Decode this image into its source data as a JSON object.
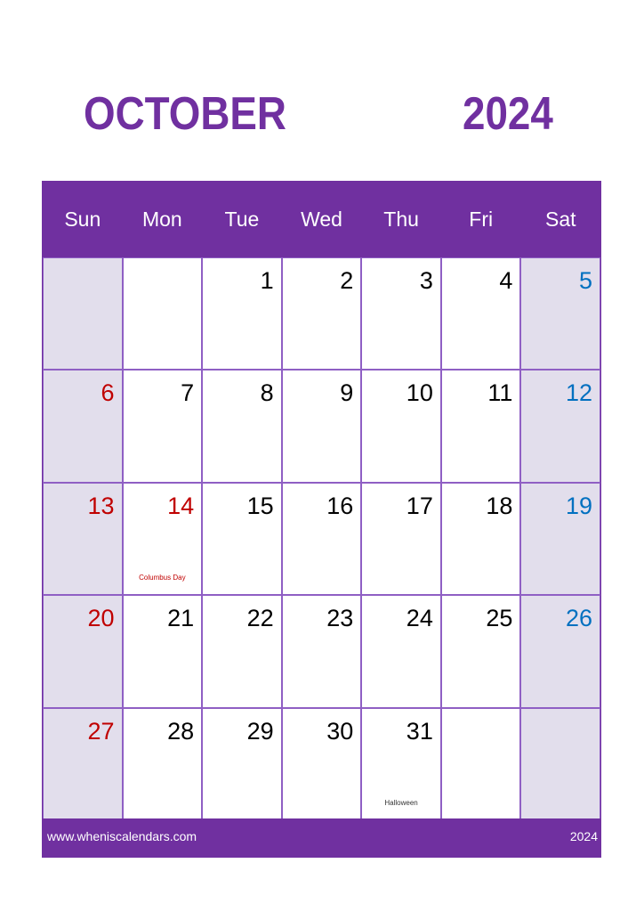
{
  "header": {
    "month": "OCTOBER",
    "year": "2024"
  },
  "weekdays": [
    "Sun",
    "Mon",
    "Tue",
    "Wed",
    "Thu",
    "Fri",
    "Sat"
  ],
  "weeks": [
    [
      {
        "day": ""
      },
      {
        "day": ""
      },
      {
        "day": "1"
      },
      {
        "day": "2"
      },
      {
        "day": "3"
      },
      {
        "day": "4"
      },
      {
        "day": "5"
      }
    ],
    [
      {
        "day": "6"
      },
      {
        "day": "7"
      },
      {
        "day": "8"
      },
      {
        "day": "9"
      },
      {
        "day": "10"
      },
      {
        "day": "11"
      },
      {
        "day": "12"
      }
    ],
    [
      {
        "day": "13"
      },
      {
        "day": "14",
        "holiday": "Columbus Day",
        "holiday_style": "red"
      },
      {
        "day": "15"
      },
      {
        "day": "16"
      },
      {
        "day": "17"
      },
      {
        "day": "18"
      },
      {
        "day": "19"
      }
    ],
    [
      {
        "day": "20"
      },
      {
        "day": "21"
      },
      {
        "day": "22"
      },
      {
        "day": "23"
      },
      {
        "day": "24"
      },
      {
        "day": "25"
      },
      {
        "day": "26"
      }
    ],
    [
      {
        "day": "27"
      },
      {
        "day": "28"
      },
      {
        "day": "29"
      },
      {
        "day": "30"
      },
      {
        "day": "31",
        "holiday": "Halloween",
        "holiday_style": "black"
      },
      {
        "day": ""
      },
      {
        "day": ""
      }
    ]
  ],
  "footer": {
    "website": "www.wheniscalendars.com",
    "year": "2024"
  },
  "colors": {
    "accent": "#7030a0",
    "weekend_bg": "#e2deec",
    "sunday": "#c00000",
    "saturday": "#0070c0",
    "holiday": "#c00000"
  }
}
